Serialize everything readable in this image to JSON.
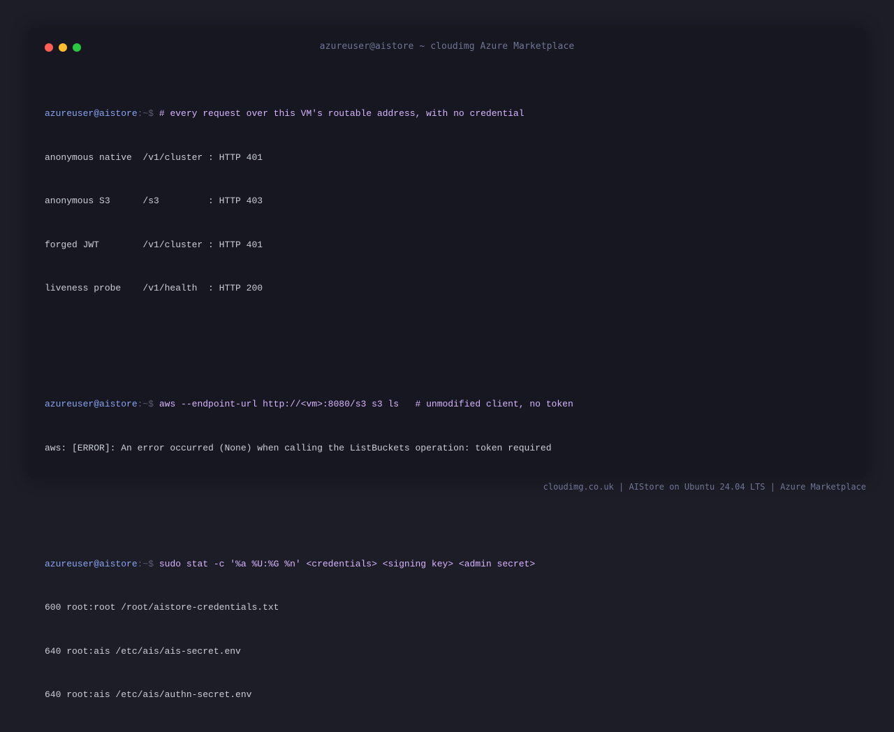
{
  "window": {
    "title": "azureuser@aistore ~ cloudimg Azure Marketplace"
  },
  "prompt": {
    "user": "azureuser@aistore",
    "separator": ":~$ "
  },
  "blocks": [
    {
      "command": "# every request over this VM's routable address, with no credential",
      "output": [
        "anonymous native  /v1/cluster : HTTP 401",
        "anonymous S3      /s3         : HTTP 403",
        "forged JWT        /v1/cluster : HTTP 401",
        "liveness probe    /v1/health  : HTTP 200"
      ]
    },
    {
      "command": "aws --endpoint-url http://<vm>:8080/s3 s3 ls   # unmodified client, no token",
      "output": [
        "aws: [ERROR]: An error occurred (None) when calling the ListBuckets operation: token required"
      ]
    },
    {
      "command": "sudo stat -c '%a %U:%G %n' <credentials> <signing key> <admin secret>",
      "output": [
        "600 root:root /root/aistore-credentials.txt",
        "640 root:ais /etc/ais/ais-secret.env",
        "640 root:ais /etc/ais/authn-secret.env"
      ]
    }
  ],
  "footer": {
    "text": "cloudimg.co.uk | AIStore on Ubuntu 24.04 LTS | Azure Marketplace"
  },
  "colors": {
    "prompt_user": "#8aa4f2",
    "command": "#d8b4fe",
    "output": "#c9cdd8",
    "close": "#ff5f57",
    "minimize": "#febc2e",
    "maximize": "#28c840"
  }
}
